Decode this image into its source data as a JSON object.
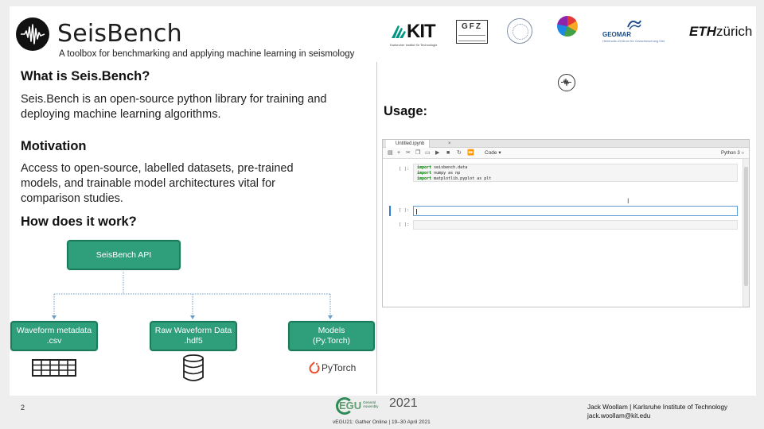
{
  "header": {
    "brand": "SeisBench",
    "tagline": "A toolbox for benchmarking and applying machine learning in seismology",
    "partner_logos": [
      "KIT",
      "GFZ",
      "seal",
      "globe",
      "GEOMAR",
      "ETH zürich"
    ],
    "kit_text": "KIT",
    "kit_subtitle": "Karlsruher Institut für Technologie",
    "gfz_text": "GFZ",
    "geomar_text": "GEOMAR",
    "geomar_subtitle": "Helmholtz-Zentrum für Ozeanforschung Kiel",
    "eth_bold": "ETH",
    "eth_rest": "zürich"
  },
  "sections": {
    "what_heading": "What is Seis.Bench?",
    "what_text": "Seis.Bench is an open-source python library for training and deploying machine learning algorithms.",
    "motivation_heading": "Motivation",
    "motivation_text": "Access to open-source, labelled datasets,  pre-trained models, and trainable model architectures vital for comparison studies.",
    "how_heading": "How does it work?",
    "usage_heading": "Usage:"
  },
  "diagram": {
    "root": "SeisBench API",
    "children": [
      {
        "label_line1": "Waveform metadata",
        "label_line2": ".csv",
        "icon": "table-icon"
      },
      {
        "label_line1": "Raw Waveform Data",
        "label_line2": ".hdf5",
        "icon": "database-icon"
      },
      {
        "label_line1": "Models",
        "label_line2": "(Py.Torch)",
        "icon": "pytorch-logo-icon"
      }
    ],
    "pytorch_text": "PyTorch"
  },
  "notebook": {
    "tab_name": "Untitled.ipynb",
    "kernel_dropdown": "Code",
    "kernel_name": "Python 3",
    "cells": [
      {
        "prompt": "[ ]:",
        "lines": [
          {
            "kw": "import",
            "rest": " seisbench.data"
          },
          {
            "kw": "import",
            "rest": " numpy as np"
          },
          {
            "kw": "import",
            "rest": " matplotlib.pyplot as plt"
          }
        ]
      },
      {
        "prompt": "[ ]:",
        "lines": []
      },
      {
        "prompt": "[ ]:",
        "lines": []
      }
    ],
    "toolbar_icons": [
      "save-icon",
      "add-icon",
      "cut-icon",
      "copy-icon",
      "paste-icon",
      "run-icon",
      "stop-icon",
      "restart-icon",
      "fast-forward-icon"
    ]
  },
  "footer": {
    "page_number": "2",
    "egu_word": "EGU",
    "egu_assembly": "General Assembly",
    "egu_year": "2021",
    "egu_subtitle": "vEGU21: Gather Online | 19–30 April 2021",
    "credit_line1": "Jack Woollam | Karlsruhe Institute of Technology",
    "credit_line2": "jack.woollam@kit.edu"
  },
  "colors": {
    "node_fill": "#2f9e7b",
    "node_border": "#1e7a5c",
    "connector": "#6a9ec9",
    "egu_green": "#2e8b57"
  }
}
